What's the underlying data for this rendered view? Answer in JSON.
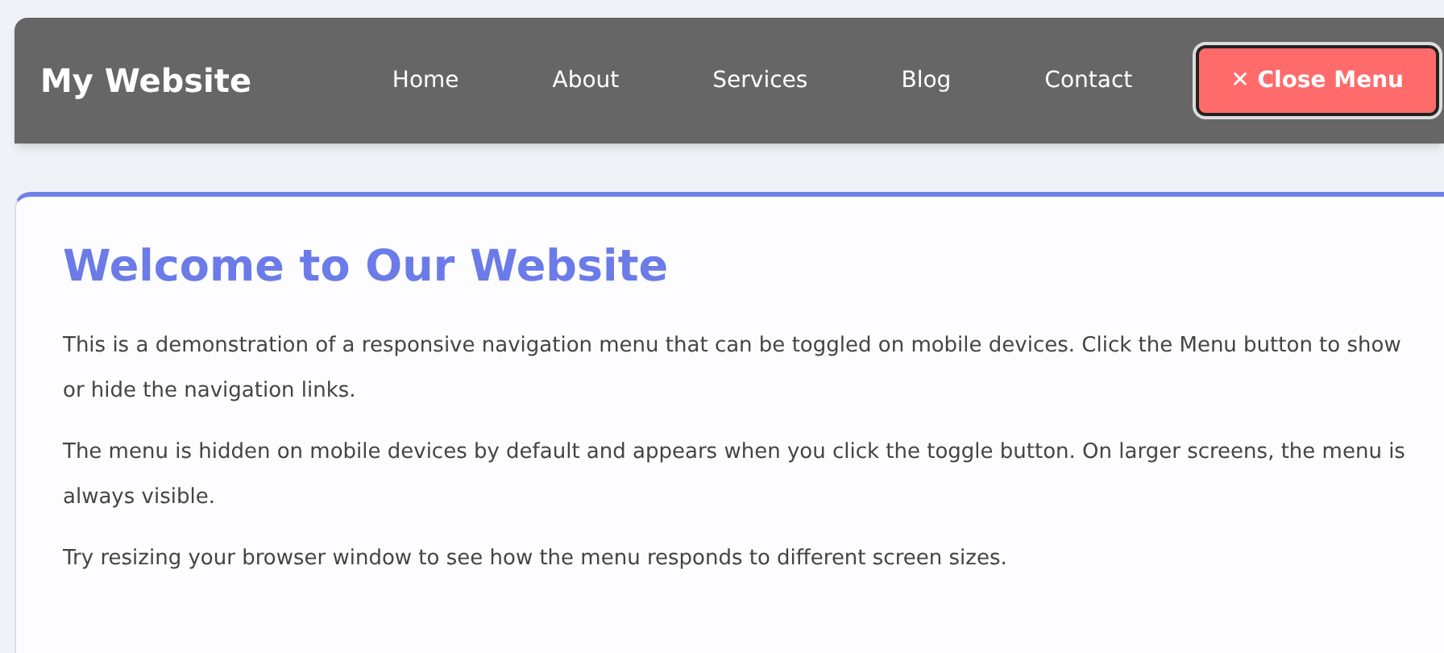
{
  "header": {
    "logo": "My Website",
    "nav": [
      "Home",
      "About",
      "Services",
      "Blog",
      "Contact"
    ],
    "toggle_button": {
      "icon": "✕",
      "label": "Close Menu",
      "expanded": true
    }
  },
  "content": {
    "title": "Welcome to Our Website",
    "paragraphs": [
      "This is a demonstration of a responsive navigation menu that can be toggled on mobile devices. Click the Menu button to show or hide the navigation links.",
      "The menu is hidden on mobile devices by default and appears when you click the toggle button. On larger screens, the menu is always visible.",
      "Try resizing your browser window to see how the menu responds to different screen sizes."
    ]
  }
}
